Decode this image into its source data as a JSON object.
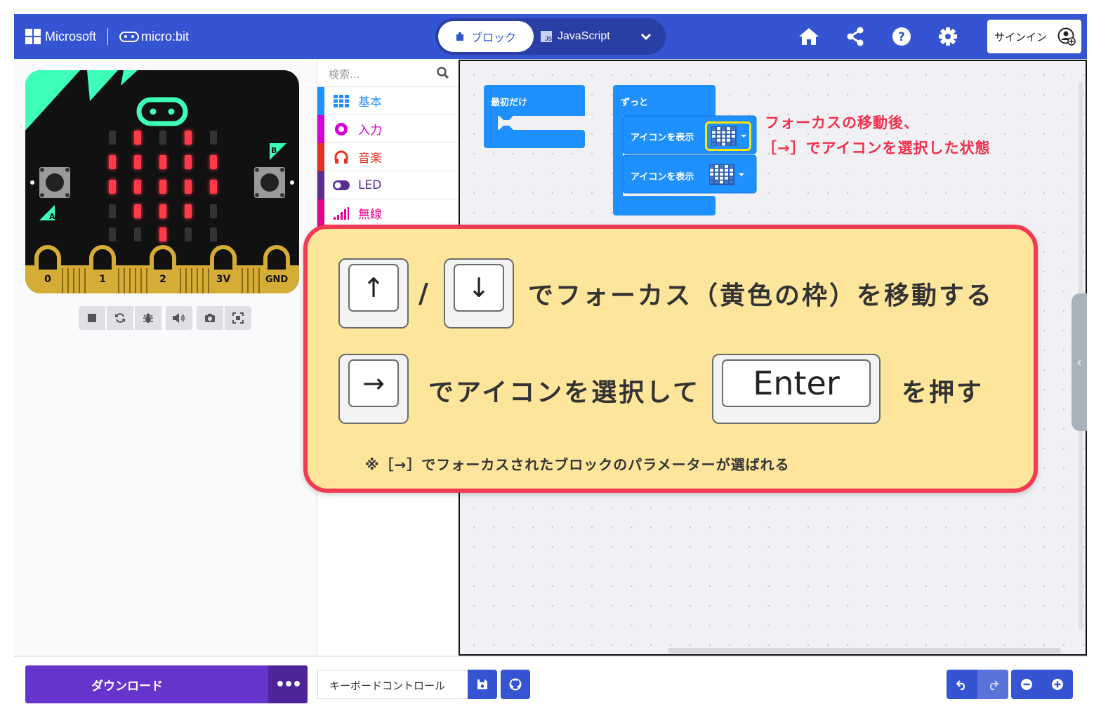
{
  "header": {
    "brand_ms": "Microsoft",
    "brand_mb": "micro:bit",
    "mode_blocks": "ブロック",
    "mode_js": "JavaScript",
    "js_badge": "JS",
    "icons": [
      "home-icon",
      "share-icon",
      "help-icon",
      "settings-icon",
      "chevron-down-icon"
    ],
    "signin": "サインイン"
  },
  "simulator": {
    "buttons": {
      "a": "A",
      "b": "B"
    },
    "pins": [
      "0",
      "1",
      "2",
      "3V",
      "GND"
    ],
    "led_on": [
      [
        0,
        1,
        0,
        1,
        0
      ],
      [
        1,
        1,
        1,
        1,
        1
      ],
      [
        1,
        1,
        1,
        1,
        1
      ],
      [
        0,
        1,
        1,
        1,
        0
      ],
      [
        0,
        0,
        1,
        0,
        0
      ]
    ],
    "toolbar_icons": [
      "stop-icon",
      "restart-icon",
      "debug-icon",
      "sound-icon",
      "screenshot-icon",
      "fullscreen-icon"
    ]
  },
  "toolbox": {
    "search_placeholder": "検索...",
    "categories": [
      {
        "label": "基本",
        "color": "#1e90ff"
      },
      {
        "label": "入力",
        "color": "#d400d4"
      },
      {
        "label": "音楽",
        "color": "#e63022"
      },
      {
        "label": "LED",
        "color": "#5c2d91"
      },
      {
        "label": "無線",
        "color": "#e3008c"
      }
    ]
  },
  "workspace": {
    "block_on_start": "最初だけ",
    "block_forever": "ずっと",
    "block_show_icon_1": "アイコンを表示",
    "block_show_icon_2": "アイコンを表示",
    "annotation_line1": "フォーカスの移動後、",
    "annotation_line2": "［→］でアイコンを選択した状態"
  },
  "callout": {
    "key_up": "↑",
    "slash": "/",
    "key_down": "↓",
    "line1": "でフォーカス（黄色の枠）を移動する",
    "key_right": "→",
    "line2_a": "でアイコンを選択して",
    "key_enter": "Enter",
    "line2_b": "を押す",
    "note": "※［→］でフォーカスされたブロックのパラメーターが選ばれる"
  },
  "footer": {
    "download": "ダウンロード",
    "more": "•••",
    "project_name": "キーボードコントロール"
  },
  "colors": {
    "header_bg": "#3454d1",
    "download_bg": "#6633cc",
    "callout_bg": "#fde59b",
    "callout_border": "#f23a52",
    "block_blue": "#1e90ff",
    "focus_yellow": "#ffe600",
    "led_red": "#ff3a4a"
  }
}
